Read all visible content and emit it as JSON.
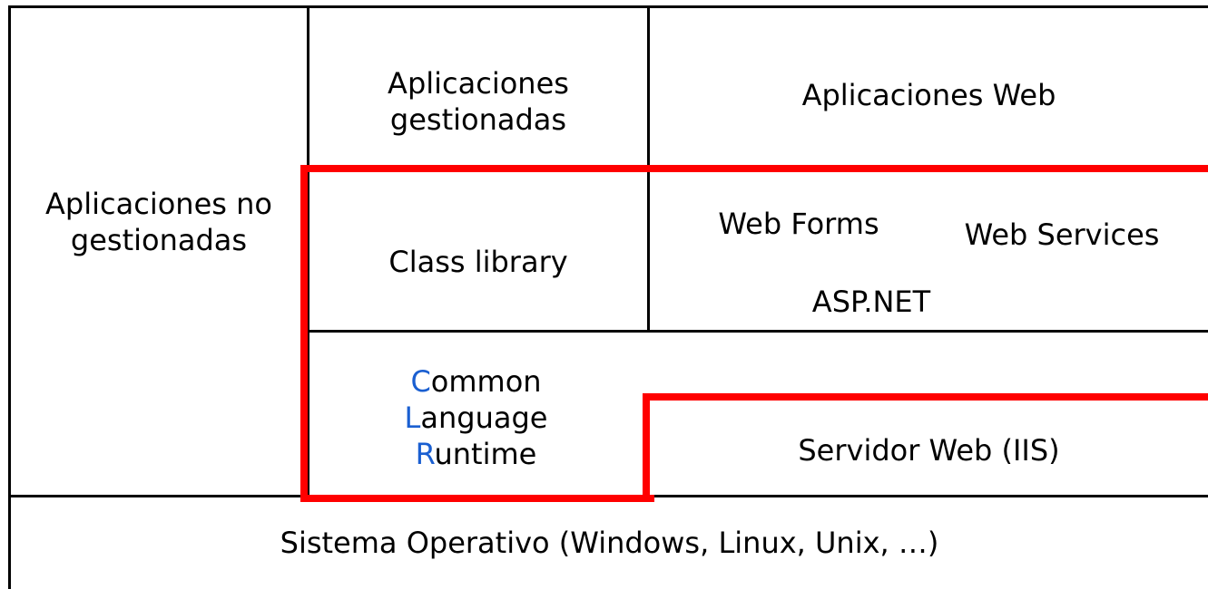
{
  "cells": {
    "unmanaged_apps": [
      "Aplicaciones no",
      "gestionadas"
    ],
    "managed_apps": [
      "Aplicaciones",
      "gestionadas"
    ],
    "web_apps": "Aplicaciones Web",
    "class_library": "Class library",
    "web_forms": "Web Forms",
    "web_services": "Web Services",
    "aspnet": "ASP.NET",
    "clr": [
      {
        "initial": "C",
        "rest": "ommon"
      },
      {
        "initial": "L",
        "rest": "anguage"
      },
      {
        "initial": "R",
        "rest": "untime"
      }
    ],
    "web_server": "Servidor Web (IIS)",
    "os": "Sistema Operativo (Windows, Linux, Unix, …)"
  },
  "colors": {
    "highlight": "#ff0000",
    "clr_initials": "#1a5fd1",
    "lines": "#000000"
  }
}
